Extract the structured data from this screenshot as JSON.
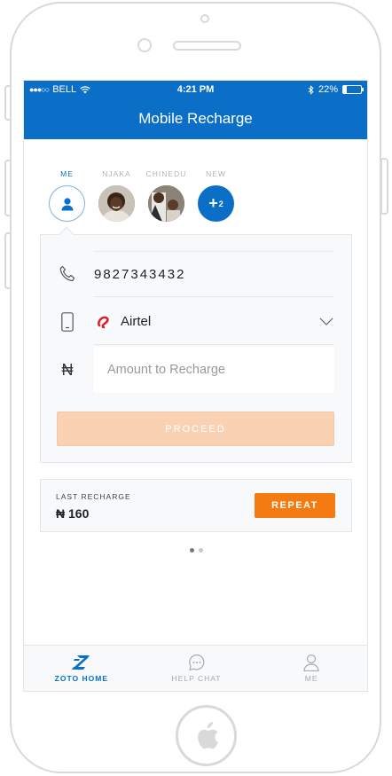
{
  "status_bar": {
    "carrier": "BELL",
    "time": "4:21 PM",
    "battery": "22%",
    "battery_level": 0.22
  },
  "header": {
    "title": "Mobile Recharge"
  },
  "contacts": [
    {
      "label": "ME",
      "type": "self",
      "active": true
    },
    {
      "label": "NJAKA",
      "type": "photo"
    },
    {
      "label": "CHINEDU",
      "type": "photo"
    },
    {
      "label": "NEW",
      "type": "new",
      "badge": "+",
      "count": "2"
    }
  ],
  "form": {
    "phone_number": "9827343432",
    "operator": "Airtel",
    "amount_placeholder": "Amount to Recharge",
    "currency_symbol": "₦",
    "proceed_label": "PROCEED"
  },
  "last_recharge": {
    "label": "LAST RECHARGE",
    "amount": "₦ 160",
    "repeat_label": "REPEAT"
  },
  "pager": {
    "pages": 2,
    "current": 1
  },
  "tabs": [
    {
      "label": "ZOTO HOME",
      "icon": "zoto-logo-icon",
      "active": true
    },
    {
      "label": "HELP CHAT",
      "icon": "chat-bubble-icon"
    },
    {
      "label": "ME",
      "icon": "user-icon"
    }
  ],
  "colors": {
    "primary": "#0b6fc8",
    "accent": "#f47a12",
    "proceed_disabled": "#f9d2b3",
    "airtel_red": "#e31e26"
  }
}
